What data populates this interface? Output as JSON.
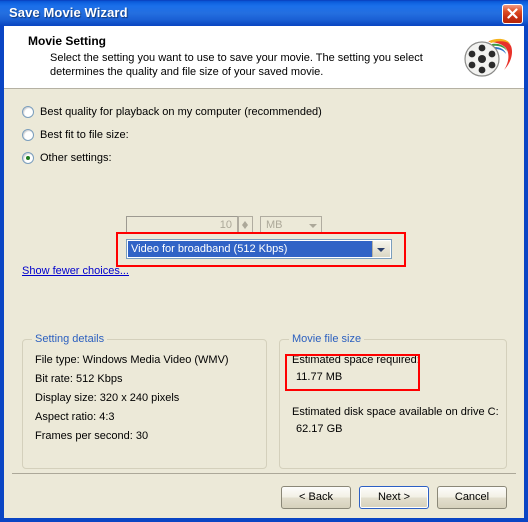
{
  "window": {
    "title": "Save Movie Wizard",
    "close_icon": "close-icon"
  },
  "header": {
    "title": "Movie Setting",
    "description": "Select the setting you want to use to save your movie. The setting you select determines the quality and file size of your saved movie.",
    "icon": "movie-reel-icon"
  },
  "options": {
    "best_quality_label": "Best quality for playback on my computer (recommended)",
    "best_fit_label": "Best fit to file size:",
    "other_settings_label": "Other settings:",
    "file_size_value": "10",
    "file_size_unit": "MB",
    "selected_profile": "Video for broadband (512 Kbps)",
    "show_fewer_link": "Show fewer choices..."
  },
  "setting_details": {
    "legend": "Setting details",
    "lines": [
      "File type: Windows Media Video (WMV)",
      "Bit rate: 512 Kbps",
      "Display size: 320 x 240 pixels",
      "Aspect ratio: 4:3",
      "Frames per second: 30"
    ]
  },
  "movie_file_size": {
    "legend": "Movie file size",
    "required_label": "Estimated space required:",
    "required_value": "11.77 MB",
    "available_label": "Estimated disk space available on drive C:",
    "available_value": "62.17 GB"
  },
  "buttons": {
    "back": "< Back",
    "next": "Next >",
    "cancel": "Cancel"
  },
  "colors": {
    "title_bar": "#1B6FEA",
    "body": "#ECE9D8",
    "selection": "#3163C6",
    "annotation": "#FF0000",
    "link": "#0000CC",
    "legend": "#2B5FBF"
  }
}
